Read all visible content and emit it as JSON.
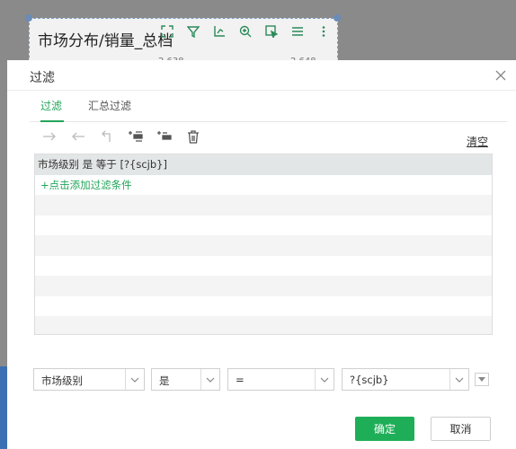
{
  "background": {
    "widget_title": "市场分布/销量_总档",
    "values": [
      "2,638",
      "2,648"
    ]
  },
  "dialog": {
    "title": "过滤",
    "tabs": [
      {
        "label": "过滤",
        "active": true
      },
      {
        "label": "汇总过滤",
        "active": false
      }
    ],
    "toolbar": {
      "icons": [
        "redo-arrow-icon",
        "undo-arrow-icon",
        "return-icon",
        "add-condition-icon",
        "add-group-icon",
        "delete-icon"
      ],
      "clear_label": "清空"
    },
    "conditions": [
      {
        "text": "市场级别 是 等于 [?{scjb}]"
      }
    ],
    "add_condition_label": "+点击添加过滤条件",
    "editor": {
      "field": "市场级别",
      "relation": "是",
      "operator": "=",
      "value": "?{scjb}"
    },
    "buttons": {
      "confirm": "确定",
      "cancel": "取消"
    }
  },
  "colors": {
    "accent": "#23a55a",
    "primary_button": "#1fae58",
    "overlay": "#8a8a8a"
  }
}
